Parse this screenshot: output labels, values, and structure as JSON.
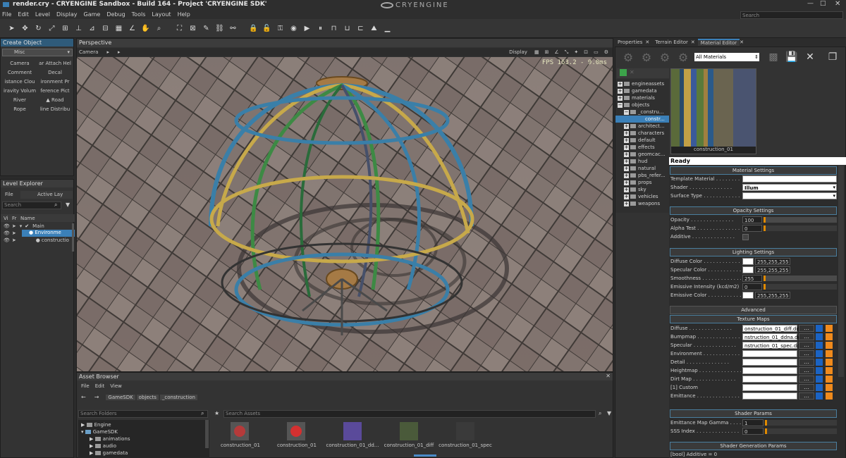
{
  "window": {
    "title": "render.cry - CRYENGINE Sandbox - Build 164 - Project 'CRYENGINE SDK'",
    "logo": "CRYENGINE",
    "search_placeholder": "Search"
  },
  "menu": [
    "File",
    "Edit",
    "Level",
    "Display",
    "Game",
    "Debug",
    "Tools",
    "Layout",
    "Help"
  ],
  "create_object": {
    "title": "Create Object",
    "category": "Misc",
    "items": [
      "Camera",
      "ar Attach Hel",
      "Comment",
      "Decal",
      "istance Clou",
      "ironment Pr",
      "iravity Volum",
      "ference Pict",
      "River",
      "Road",
      "Rope",
      "line Distribu"
    ]
  },
  "level_explorer": {
    "title": "Level Explorer",
    "file_label": "File",
    "active_layer": "Active Lay",
    "search_placeholder": "Search",
    "columns": [
      "Vi",
      "Fr",
      "Name"
    ],
    "rows": [
      "Main",
      "Environme",
      "constructio"
    ]
  },
  "viewport": {
    "title": "Perspective",
    "camera_label": "Camera",
    "display_label": "Display",
    "fps": "FPS 163.2 - 9.0ms"
  },
  "asset_browser": {
    "title": "Asset Browser",
    "menu": [
      "File",
      "Edit",
      "View"
    ],
    "breadcrumbs": [
      "GameSDK",
      "objects",
      "_construction"
    ],
    "search_folders": "Search Folders",
    "search_assets": "Search Assets",
    "folders": [
      "Engine",
      "GameSDK",
      "animations",
      "audio",
      "gamedata"
    ],
    "assets": [
      "construction_01",
      "construction_01",
      "construction_01_dd...",
      "construction_01_diff",
      "construction_01_spec"
    ]
  },
  "tabs": [
    "Properties",
    "Terrain Editor",
    "Material Editor"
  ],
  "material_editor": {
    "filter": "All Materials",
    "tree": [
      "engineassets",
      "gamedata",
      "materials",
      "objects",
      "_constru...",
      "constr...",
      "architect...",
      "characters",
      "default",
      "effects",
      "geomcac...",
      "hud",
      "natural",
      "pbs_refer...",
      "props",
      "sky",
      "vehicles",
      "weapons"
    ],
    "preview_label": "construction_01",
    "status": "Ready",
    "material_settings": {
      "title": "Material Settings",
      "template_label": "Template Material",
      "shader_label": "Shader",
      "shader_value": "Illum",
      "surface_label": "Surface Type"
    },
    "opacity_settings": {
      "title": "Opacity Settings",
      "opacity_label": "Opacity",
      "opacity_value": "100",
      "alpha_label": "Alpha Test",
      "alpha_value": "0",
      "additive_label": "Additive"
    },
    "lighting_settings": {
      "title": "Lighting Settings",
      "diffuse_label": "Diffuse Color",
      "diffuse_value": "255,255,255",
      "specular_label": "Specular Color",
      "specular_value": "255,255,255",
      "smooth_label": "Smoothness",
      "smooth_value": "255",
      "emint_label": "Emissive Intensity (kcd/m2)",
      "emint_value": "0",
      "emcolor_label": "Emissive Color",
      "emcolor_value": "255,255,255"
    },
    "advanced": "Advanced",
    "texture_maps": {
      "title": "Texture Maps",
      "items": [
        {
          "label": "Diffuse",
          "value": "onstruction_01_diff.dds"
        },
        {
          "label": "Bumpmap",
          "value": "nstruction_01_ddna.dds"
        },
        {
          "label": "Specular",
          "value": "nstruction_01_spec.dds"
        },
        {
          "label": "Environment",
          "value": ""
        },
        {
          "label": "Detail",
          "value": ""
        },
        {
          "label": "Heightmap",
          "value": ""
        },
        {
          "label": "Dirt Map",
          "value": ""
        },
        {
          "label": "[1] Custom",
          "value": ""
        },
        {
          "label": "Emittance",
          "value": ""
        }
      ]
    },
    "shader_params": {
      "title": "Shader Params",
      "gamma_label": "Emittance Map Gamma",
      "gamma_value": "1",
      "sss_label": "SSS Index",
      "sss_value": "0"
    },
    "gen_params": "Shader Generation Params",
    "gen_first": "[bool] Additive = 0"
  }
}
